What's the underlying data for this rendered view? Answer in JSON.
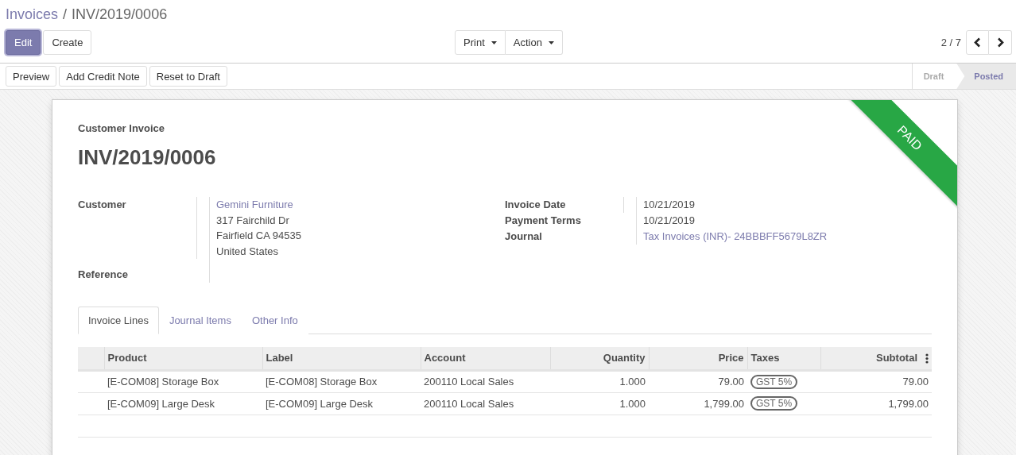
{
  "breadcrumbs": [
    {
      "label": "Invoices",
      "kind": "link"
    },
    {
      "label": "INV/2019/0006",
      "kind": "current"
    }
  ],
  "breadcrumb_separator": "/",
  "buttons": [
    {
      "label": "Edit",
      "kind": "primary"
    },
    {
      "label": "Create",
      "kind": "default"
    }
  ],
  "menus": [
    {
      "label": "Print"
    },
    {
      "label": "Action"
    }
  ],
  "pager": {
    "counter": "2 / 7"
  },
  "action_buttons": [
    "Preview",
    "Add Credit Note",
    "Reset to Draft"
  ],
  "status_steps": [
    {
      "label": "Draft",
      "selected": false
    },
    {
      "label": "Posted",
      "selected": true
    }
  ],
  "sheet": {
    "ribbon": "PAID",
    "subtitle": "Customer Invoice",
    "title": "INV/2019/0006",
    "left_fields": [
      {
        "label": "Customer",
        "values": [
          {
            "text": "Gemini Furniture",
            "kind": "link"
          },
          {
            "text": "317 Fairchild Dr",
            "kind": "text"
          },
          {
            "text": "Fairfield CA 94535",
            "kind": "text"
          },
          {
            "text": "United States",
            "kind": "text"
          }
        ]
      },
      {
        "label": "Reference"
      }
    ],
    "right_fields": [
      {
        "label": "Invoice Date",
        "values": [
          {
            "text": "10/21/2019",
            "kind": "text"
          }
        ]
      },
      {
        "label": "Payment Terms",
        "values": [
          {
            "text": "10/21/2019",
            "kind": "text"
          }
        ]
      },
      {
        "label": "Journal",
        "values": [
          {
            "text": "Tax Invoices (INR)- 24BBBFF5679L8ZR",
            "kind": "link"
          }
        ]
      }
    ],
    "tabs": [
      {
        "label": "Invoice Lines",
        "selected": true
      },
      {
        "label": "Journal Items",
        "selected": false
      },
      {
        "label": "Other Info",
        "selected": false
      }
    ],
    "table": {
      "columns": [
        {
          "label": "Product",
          "kind": "text"
        },
        {
          "label": "Label",
          "kind": "text"
        },
        {
          "label": "Account",
          "kind": "text"
        },
        {
          "label": "Quantity",
          "kind": "number"
        },
        {
          "label": "Price",
          "kind": "number"
        },
        {
          "label": "Taxes",
          "kind": "tag"
        },
        {
          "label": "Subtotal",
          "kind": "number"
        }
      ],
      "rows": [
        {
          "product": "[E-COM08] Storage Box",
          "label": "[E-COM08] Storage Box",
          "account": "200110 Local Sales",
          "quantity": "1.000",
          "price": "79.00",
          "taxes": "GST 5%",
          "subtotal": "79.00"
        },
        {
          "product": "[E-COM09] Large Desk",
          "label": "[E-COM09] Large Desk",
          "account": "200110 Local Sales",
          "quantity": "1.000",
          "price": "1,799.00",
          "taxes": "GST 5%",
          "subtotal": "1,799.00"
        }
      ]
    }
  }
}
